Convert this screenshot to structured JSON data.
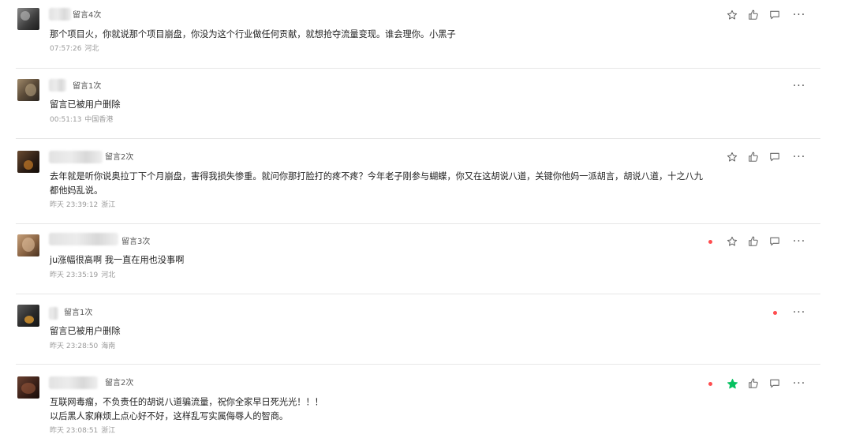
{
  "comments": [
    {
      "count": "留言4次",
      "text": "那个项目火，你就说那个项目崩盘，你没为这个行业做任何贡献，就想抢夺流量变现。谁会理你。小黑子",
      "time": "07:57:26",
      "location": "河北"
    },
    {
      "count": "留言1次",
      "text": "留言已被用户删除",
      "time": "00:51:13",
      "location": "中国香港"
    },
    {
      "count": "留言2次",
      "text": "去年就是听你说奥拉丁下个月崩盘，害得我损失惨重。就问你那打脸打的疼不疼？今年老子刚参与蝴蝶，你又在这胡说八道，关键你他妈一派胡言，胡说八道，十之八九\n都他妈乱说。",
      "time": "昨天 23:39:12",
      "location": "浙江"
    },
    {
      "count": "留言3次",
      "text": "ju涨幅很高啊 我一直在用也没事啊",
      "time": "昨天 23:35:19",
      "location": "河北"
    },
    {
      "count": "留言1次",
      "text": "留言已被用户删除",
      "time": "昨天 23:28:50",
      "location": "海南"
    },
    {
      "count": "留言2次",
      "text": "互联网毒瘤，不负责任的胡说八道骗流量，祝你全家早日死光光！！！\n以后黑人家麻烦上点心好不好，这样乱写实属侮辱人的智商。",
      "time": "昨天 23:08:51",
      "location": "浙江"
    }
  ],
  "colors": {
    "accent_green": "#07c160",
    "dot_red": "#ff4d4f",
    "icon_gray": "#666666"
  },
  "icons": [
    "star-icon",
    "thumbs-up-icon",
    "reply-icon",
    "more-icon"
  ]
}
